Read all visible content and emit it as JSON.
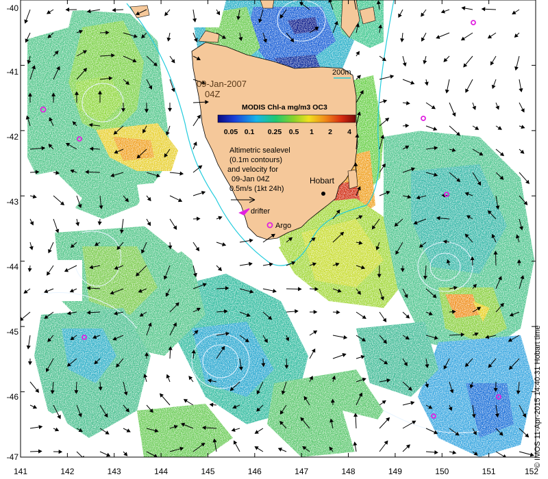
{
  "map": {
    "x_ticks": [
      "141",
      "142",
      "143",
      "144",
      "145",
      "146",
      "147",
      "148",
      "149",
      "150",
      "151",
      "152"
    ],
    "y_ticks": [
      "-40",
      "-41",
      "-42",
      "-43",
      "-44",
      "-45",
      "-46",
      "-47"
    ],
    "lon_range": [
      141,
      152
    ],
    "lat_range": [
      -47,
      -40
    ]
  },
  "annotations": {
    "date": "09-Jan-2007",
    "time": "04Z",
    "isobath": "200m",
    "colorbar_title": "MODIS Chl-a mg/m3 OC3",
    "colorbar_ticks": [
      "0.05",
      "0.1",
      "0.25",
      "0.5",
      "1",
      "2",
      "4"
    ],
    "description": [
      "Altimetric sealevel",
      "(0.1m contours)",
      "and velocity for",
      "09-Jan 04Z",
      "0.5m/s (1kt 24h)"
    ],
    "hobart": "Hobart",
    "drifter": "drifter",
    "argo": "Argo"
  },
  "credit": "© IMOS 11-Apr-2015 14:40:31 Hobart time",
  "colors": {
    "land": "#f5c89a",
    "argo": "#e020e0",
    "isobath": "#22ccdd",
    "contour": "#e8f4ff"
  }
}
